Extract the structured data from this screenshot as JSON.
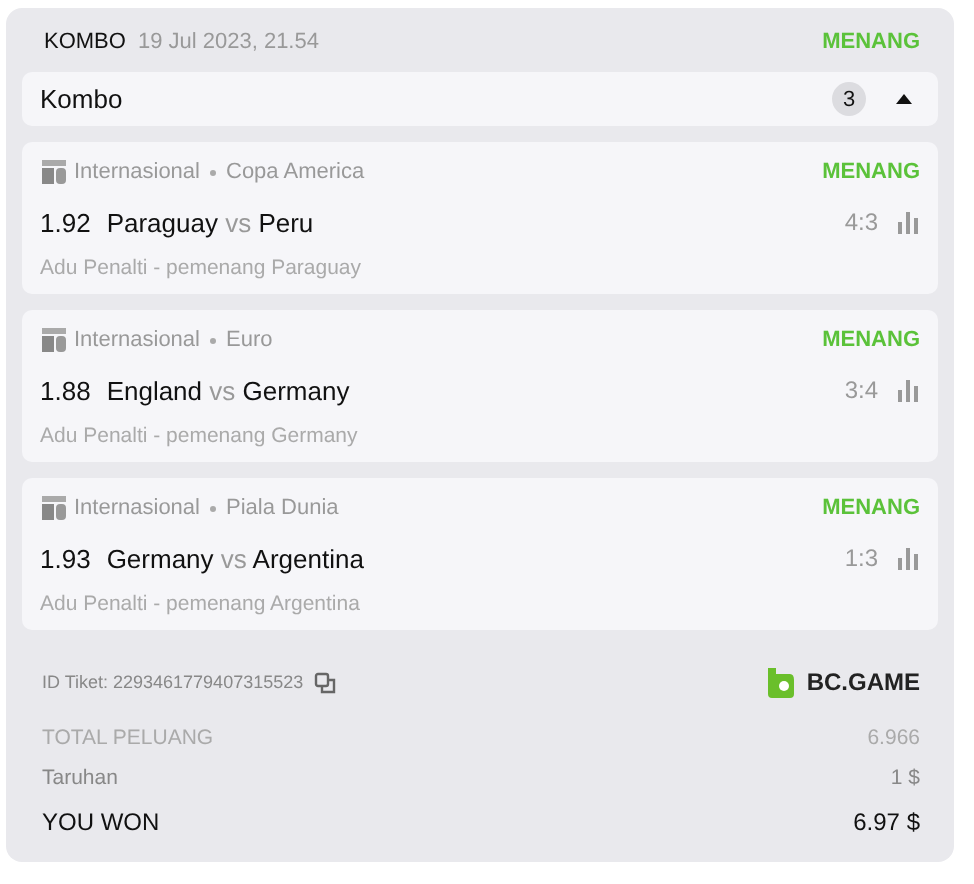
{
  "header": {
    "type": "KOMBO",
    "date": "19 Jul 2023, 21.54",
    "status": "MENANG"
  },
  "group": {
    "title": "Kombo",
    "count": "3",
    "expanded": true
  },
  "legs": [
    {
      "category": "Internasional",
      "league": "Copa America",
      "status": "MENANG",
      "odds": "1.92",
      "home": "Paraguay",
      "vs": "vs",
      "away": "Peru",
      "score": "4:3",
      "market": "Adu Penalti - pemenang Paraguay"
    },
    {
      "category": "Internasional",
      "league": "Euro",
      "status": "MENANG",
      "odds": "1.88",
      "home": "England",
      "vs": "vs",
      "away": "Germany",
      "score": "3:4",
      "market": "Adu Penalti - pemenang Germany"
    },
    {
      "category": "Internasional",
      "league": "Piala Dunia",
      "status": "MENANG",
      "odds": "1.93",
      "home": "Germany",
      "vs": "vs",
      "away": "Argentina",
      "score": "1:3",
      "market": "Adu Penalti - pemenang Argentina"
    }
  ],
  "ticket": {
    "id": "ID Tiket: 2293461779407315523",
    "brand": "BC.GAME"
  },
  "summary": [
    {
      "label": "TOTAL PELUANG",
      "value": "6.966",
      "kind": "muted"
    },
    {
      "label": "Taruhan",
      "value": "1 $",
      "kind": "normal"
    },
    {
      "label": "YOU WON",
      "value": "6.97 $",
      "kind": "total"
    }
  ]
}
